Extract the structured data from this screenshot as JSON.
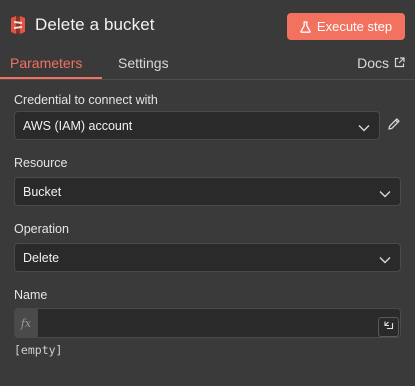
{
  "header": {
    "title": "Delete a bucket",
    "execute_label": "Execute step",
    "node_icon": "aws-s3-icon",
    "flask_icon": "flask-icon"
  },
  "tabs": {
    "parameters": "Parameters",
    "settings": "Settings",
    "docs": "Docs",
    "active": "parameters"
  },
  "fields": {
    "credential": {
      "label": "Credential to connect with",
      "value": "AWS (IAM) account"
    },
    "resource": {
      "label": "Resource",
      "value": "Bucket"
    },
    "operation": {
      "label": "Operation",
      "value": "Delete"
    },
    "name": {
      "label": "Name",
      "value": "",
      "fx_label": "fx",
      "hint": "[empty]"
    }
  },
  "colors": {
    "accent": "#f2725f",
    "background": "#3a3a3a",
    "input_background": "#2a2a2a"
  }
}
